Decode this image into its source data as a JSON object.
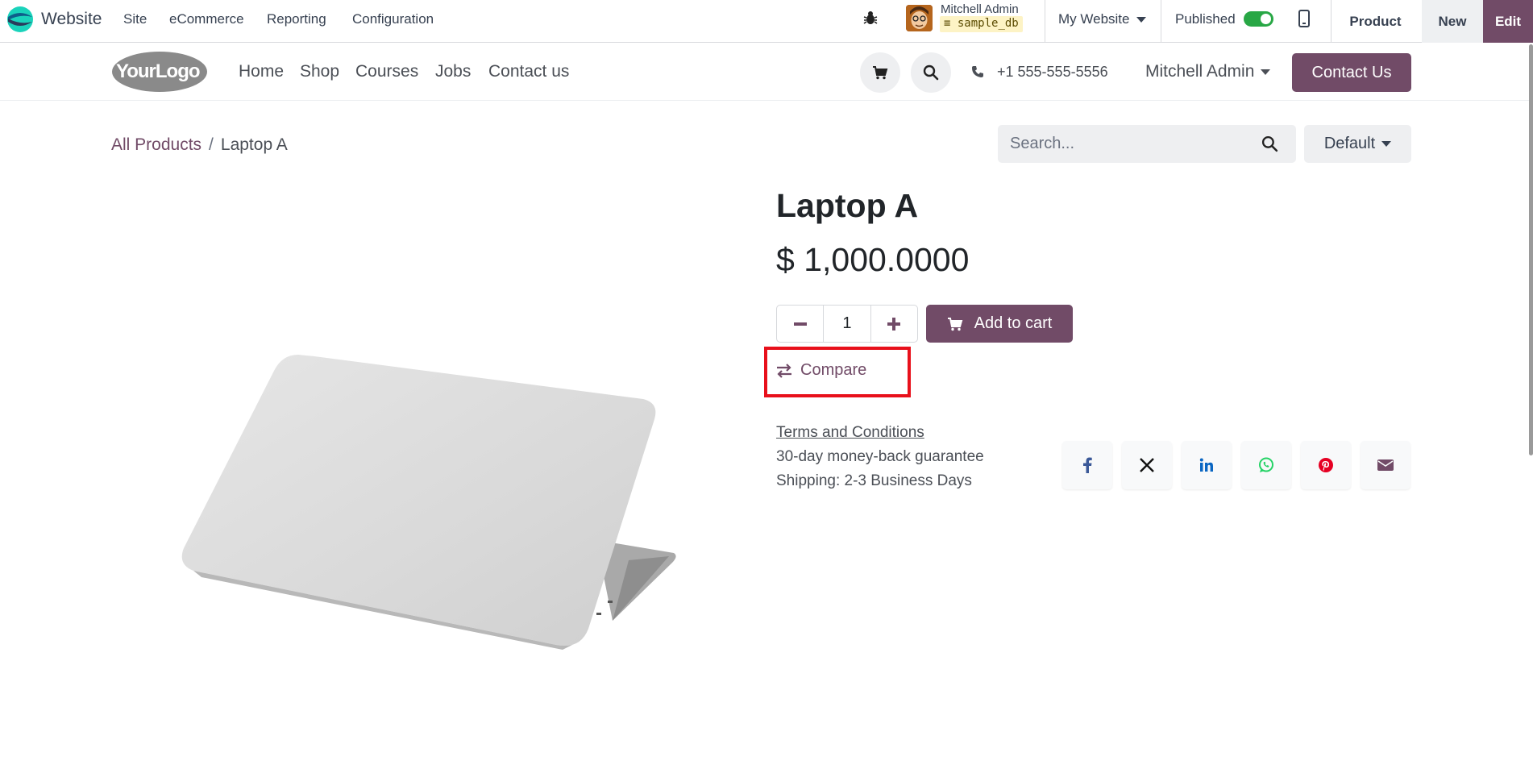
{
  "adminbar": {
    "app_name": "Website",
    "menu": [
      "Site",
      "eCommerce",
      "Reporting",
      "Configuration"
    ],
    "user_name": "Mitchell Admin",
    "db_name": "sample_db",
    "website_selector": "My Website",
    "published_label": "Published",
    "published": true,
    "product_label": "Product",
    "new_label": "New",
    "edit_label": "Edit"
  },
  "header": {
    "logo_text": "YourLogo",
    "nav": [
      "Home",
      "Shop",
      "Courses",
      "Jobs",
      "Contact us"
    ],
    "phone": "+1 555-555-5556",
    "user": "Mitchell Admin",
    "contact_button": "Contact Us"
  },
  "breadcrumb": {
    "parent": "All Products",
    "separator": "/",
    "current": "Laptop A"
  },
  "search": {
    "placeholder": "Search..."
  },
  "sort": {
    "label": "Default"
  },
  "product": {
    "name": "Laptop A",
    "price": "$ 1,000.0000",
    "quantity": "1",
    "add_to_cart": "Add to cart",
    "compare": "Compare",
    "terms": "Terms and Conditions",
    "guarantee": "30-day money-back guarantee",
    "shipping": "Shipping: 2-3 Business Days"
  },
  "share_icons": [
    "facebook-icon",
    "x-icon",
    "linkedin-icon",
    "whatsapp-icon",
    "pinterest-icon",
    "email-icon"
  ],
  "colors": {
    "brand": "#714b67",
    "published_toggle": "#28a745",
    "highlight_box": "#e8101b"
  }
}
